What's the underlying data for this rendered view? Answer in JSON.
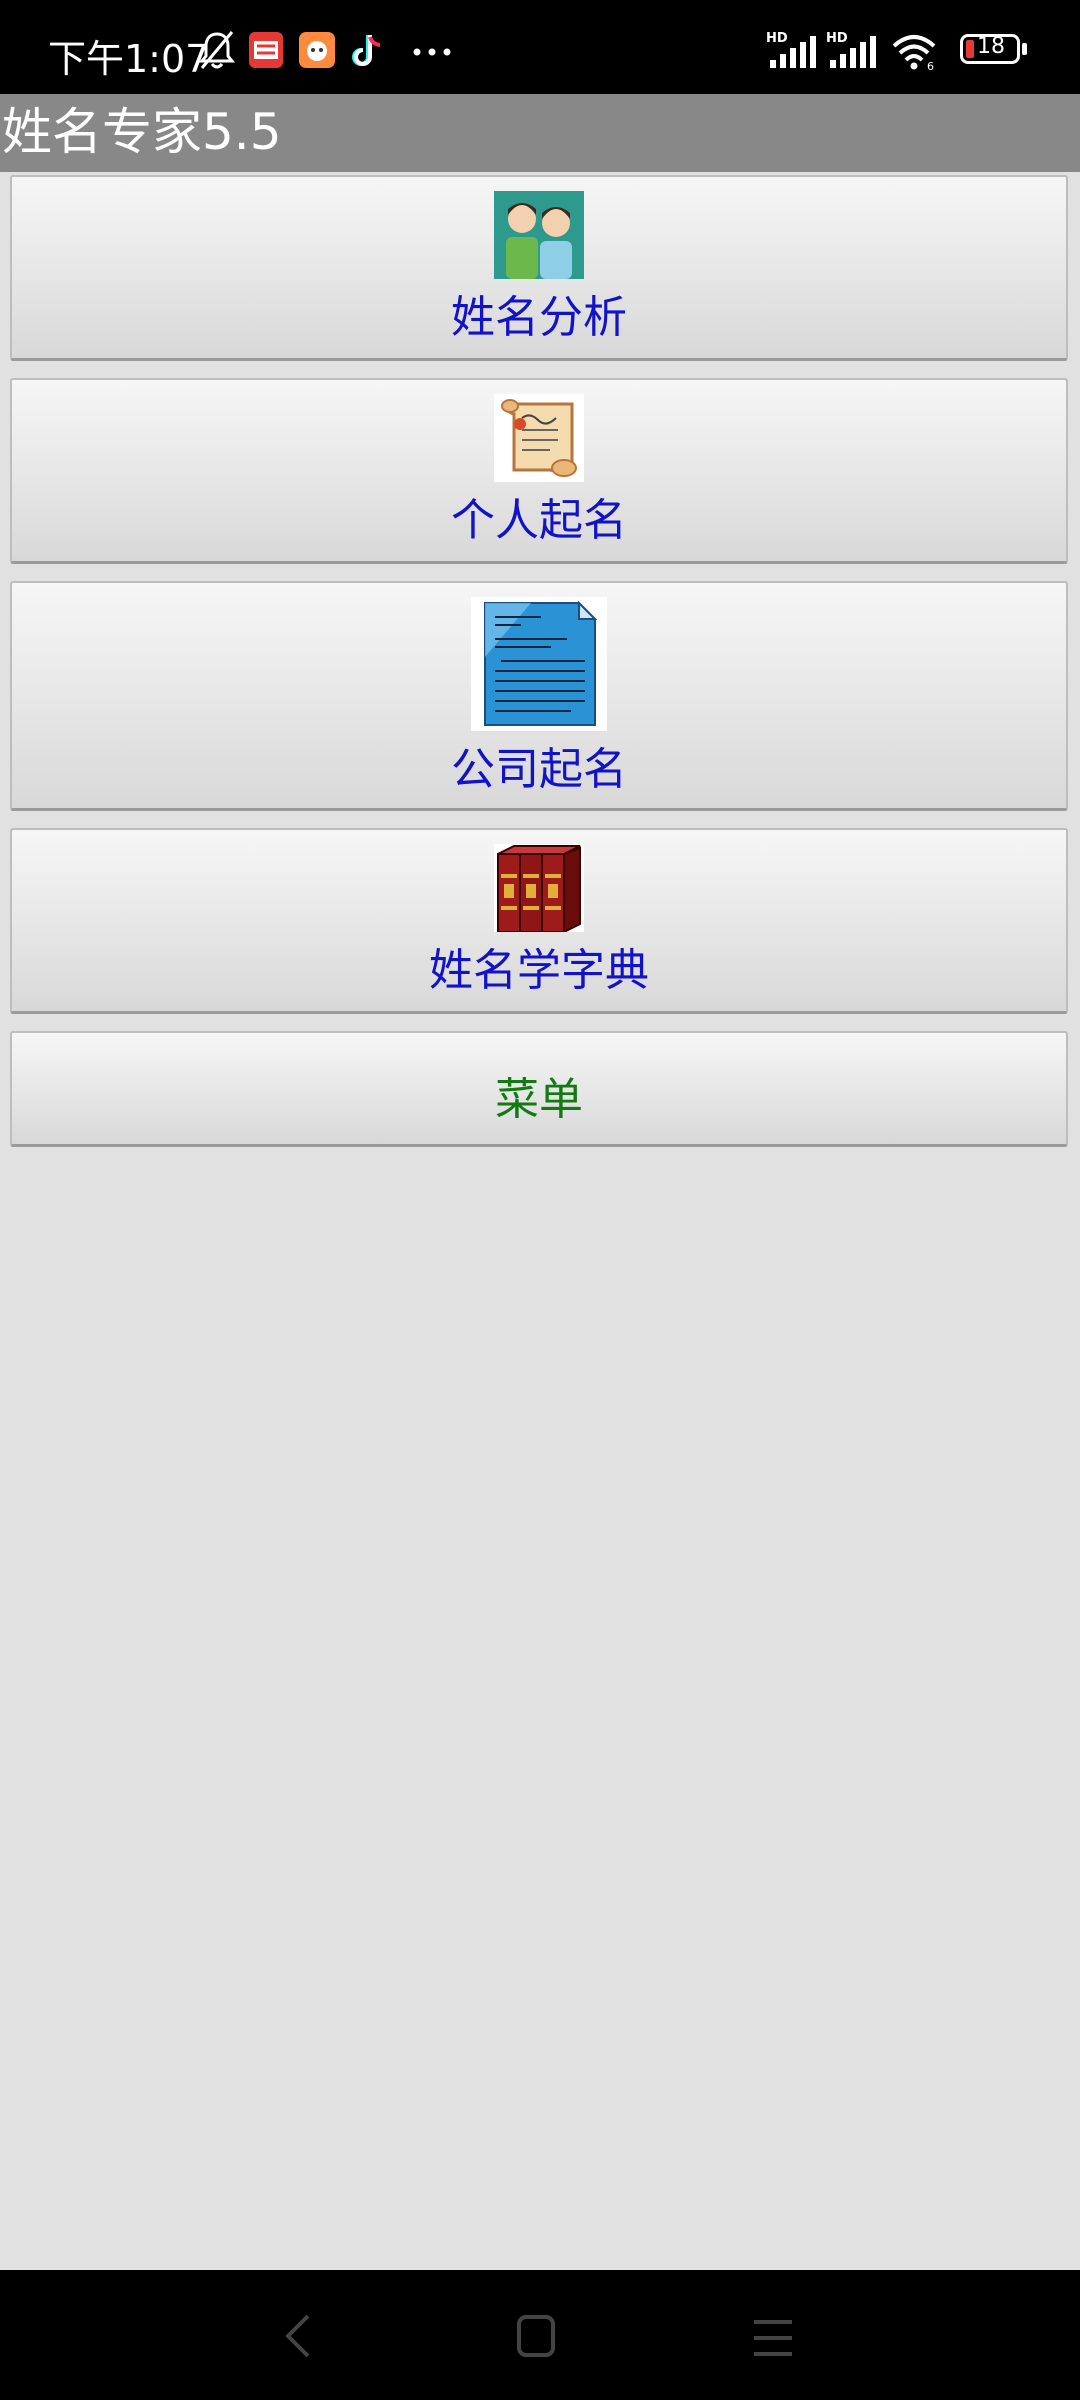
{
  "status_bar": {
    "time": "下午1:07",
    "battery": "18",
    "icons": [
      "bell-off-icon",
      "toutiao-app-icon",
      "app-notification-icon",
      "tiktok-icon",
      "more-dots-icon",
      "signal-hd-icon",
      "signal-hd-icon",
      "wifi-icon",
      "battery-icon"
    ]
  },
  "app": {
    "title": "姓名专家5.5"
  },
  "buttons": [
    {
      "label": "姓名分析",
      "icon": "two-people-icon"
    },
    {
      "label": "个人起名",
      "icon": "scroll-icon"
    },
    {
      "label": "公司起名",
      "icon": "document-icon"
    },
    {
      "label": "姓名学字典",
      "icon": "books-icon"
    },
    {
      "label": "菜单"
    }
  ],
  "colors": {
    "button_text": "#1212c8",
    "menu_text": "#117a11",
    "titlebar": "#888888",
    "background": "#e1e1e1"
  },
  "nav": [
    "back-icon",
    "home-icon",
    "recents-icon"
  ]
}
